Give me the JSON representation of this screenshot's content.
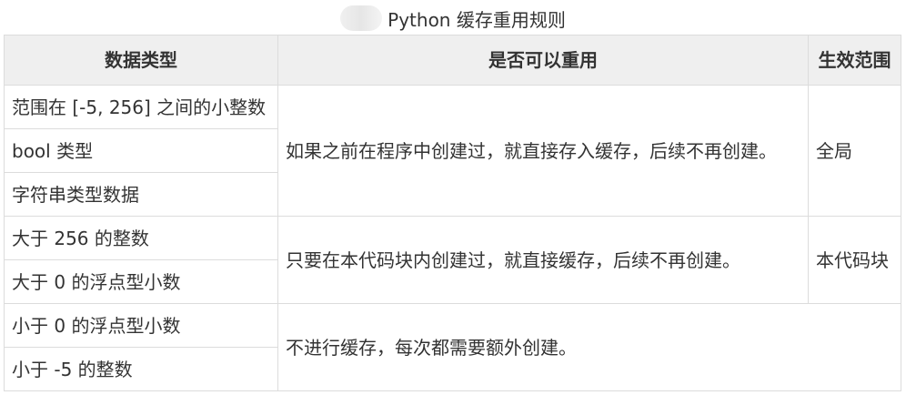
{
  "caption": {
    "title": "Python 缓存重用规则"
  },
  "table": {
    "headers": [
      "数据类型",
      "是否可以重用",
      "生效范围"
    ],
    "groups": [
      {
        "types": [
          "范围在 [-5, 256] 之间的小整数",
          "bool 类型",
          "字符串类型数据"
        ],
        "reuse": "如果之前在程序中创建过，就直接存入缓存，后续不再创建。",
        "scope": "全局"
      },
      {
        "types": [
          "大于 256 的整数",
          "大于 0 的浮点型小数"
        ],
        "reuse": "只要在本代码块内创建过，就直接缓存，后续不再创建。",
        "scope": "本代码块"
      },
      {
        "types": [
          "小于 0 的浮点型小数",
          "小于 -5 的整数"
        ],
        "reuse": "不进行缓存，每次都需要额外创建。",
        "scope": ""
      }
    ]
  }
}
